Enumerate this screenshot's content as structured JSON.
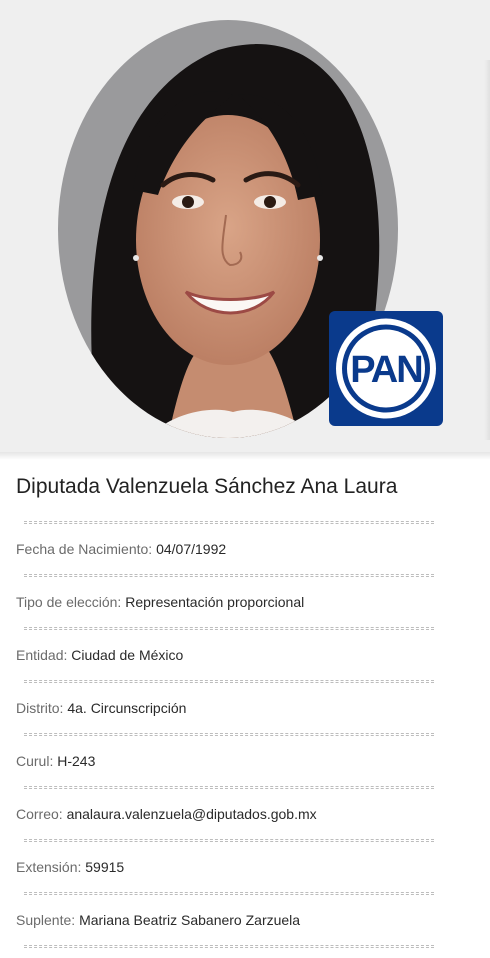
{
  "profile": {
    "name": "Diputada Valenzuela Sánchez Ana Laura",
    "fields": [
      {
        "label": "Fecha de Nacimiento:",
        "value": "04/07/1992"
      },
      {
        "label": "Tipo de elección:",
        "value": "Representación proporcional"
      },
      {
        "label": "Entidad:",
        "value": "Ciudad de México"
      },
      {
        "label": "Distrito:",
        "value": "4a. Circunscripción"
      },
      {
        "label": "Curul:",
        "value": "H-243"
      },
      {
        "label": "Correo:",
        "value": "analaura.valenzuela@diputados.gob.mx"
      },
      {
        "label": "Extensión:",
        "value": "59915"
      },
      {
        "label": "Suplente:",
        "value": "Mariana Beatriz Sabanero Zarzuela"
      }
    ]
  },
  "party_logo": {
    "text": "PAN",
    "color": "#0a3a8c"
  }
}
